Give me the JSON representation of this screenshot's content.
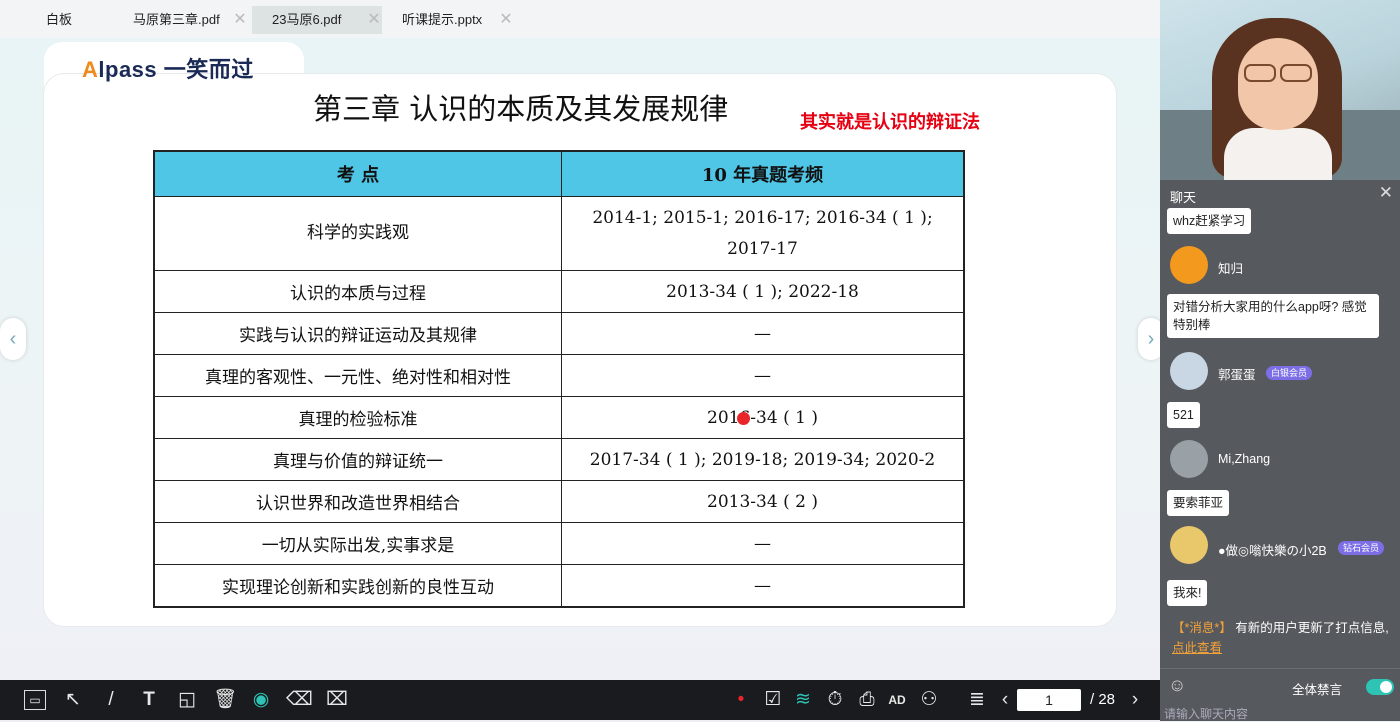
{
  "tabs": [
    {
      "label": "白板"
    },
    {
      "label": "马原第三章.pdf"
    },
    {
      "label": "23马原6.pdf"
    },
    {
      "label": "听课提示.pptx"
    }
  ],
  "slide": {
    "logo_a": "A",
    "logo_rest": "lpass 一笑而过",
    "title": "第三章   认识的本质及其发展规律",
    "annotation": "其实就是认识的辩证法",
    "table": {
      "headers": [
        "考       点",
        "10 年真题考频"
      ],
      "rows": [
        {
          "topic": "科学的实践观",
          "freq": "2014-1; 2015-1; 2016-17; 2016-34 ( 1 );",
          "freq2": "2017-17"
        },
        {
          "topic": "认识的本质与过程",
          "freq": "2013-34 ( 1 ); 2022-18"
        },
        {
          "topic": "实践与认识的辩证运动及其规律",
          "freq": "—"
        },
        {
          "topic": "真理的客观性、一元性、绝对性和相对性",
          "freq": "—"
        },
        {
          "topic": "真理的检验标准",
          "freq": "2016-34 ( 1 )"
        },
        {
          "topic": "真理与价值的辩证统一",
          "freq": "2017-34 ( 1 ); 2019-18; 2019-34; 2020-2"
        },
        {
          "topic": "认识世界和改造世界相结合",
          "freq": "2013-34 ( 2 )"
        },
        {
          "topic": "一切从实际出发,实事求是",
          "freq": "—"
        },
        {
          "topic": "实现理论创新和实践创新的良性互动",
          "freq": "—"
        }
      ]
    }
  },
  "toolbar": {
    "page_current": "1",
    "page_total": "/ 28"
  },
  "chat": {
    "title": "聊天",
    "messages": [
      {
        "text": "whz赶紧学习"
      },
      {
        "name": "知归"
      },
      {
        "text": "对错分析大家用的什么app呀? 感觉特别棒"
      },
      {
        "name": "郭蛋蛋",
        "badge": "白银会员"
      },
      {
        "text": "521"
      },
      {
        "name": "Mi,Zhang"
      },
      {
        "text": "要索菲亚"
      },
      {
        "name": "●做◎嗡快樂の小2B",
        "badge": "钻石会员"
      },
      {
        "text": "我來!"
      }
    ],
    "system_tag": "【*消息*】",
    "system_text": "有新的用户更新了打点信息,",
    "system_link": "点此查看",
    "mute_label": "全体禁言",
    "input_placeholder": "请输入聊天内容"
  },
  "colors": {
    "table_header": "#4fc6e6",
    "annotation": "#e60012",
    "toggle": "#2dc3b5",
    "system_tag": "#f3a23a"
  }
}
